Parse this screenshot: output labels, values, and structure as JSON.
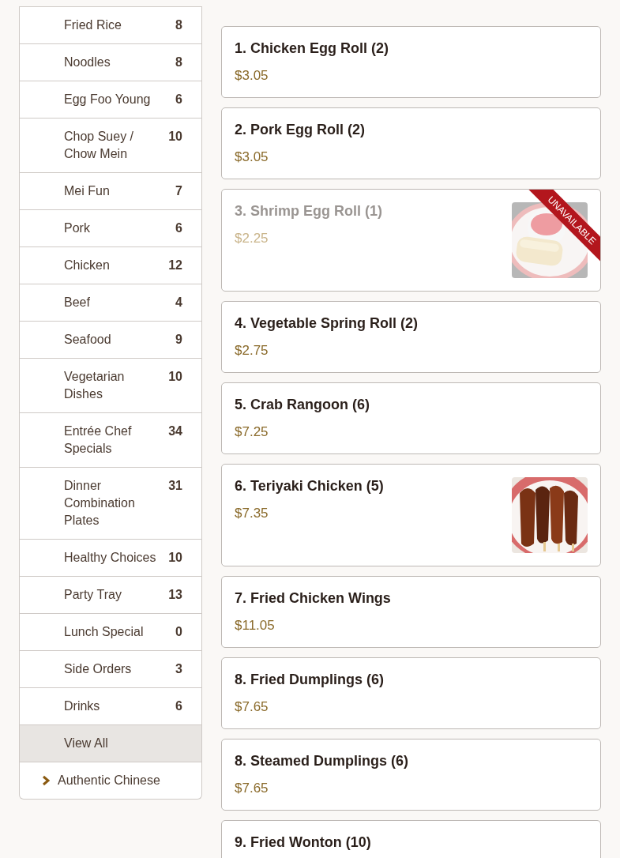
{
  "sidebar": {
    "items": [
      {
        "kind": "category",
        "label": "Fried Rice",
        "count": "8",
        "selected": false
      },
      {
        "kind": "category",
        "label": "Noodles",
        "count": "8",
        "selected": false
      },
      {
        "kind": "category",
        "label": "Egg Foo Young",
        "count": "6",
        "selected": false
      },
      {
        "kind": "category",
        "label": "Chop Suey / Chow Mein",
        "count": "10",
        "selected": false
      },
      {
        "kind": "category",
        "label": "Mei Fun",
        "count": "7",
        "selected": false
      },
      {
        "kind": "category",
        "label": "Pork",
        "count": "6",
        "selected": false
      },
      {
        "kind": "category",
        "label": "Chicken",
        "count": "12",
        "selected": false
      },
      {
        "kind": "category",
        "label": "Beef",
        "count": "4",
        "selected": false
      },
      {
        "kind": "category",
        "label": "Seafood",
        "count": "9",
        "selected": false
      },
      {
        "kind": "category",
        "label": "Vegetarian Dishes",
        "count": "10",
        "selected": false
      },
      {
        "kind": "category",
        "label": "Entrée Chef Specials",
        "count": "34",
        "selected": false
      },
      {
        "kind": "category",
        "label": "Dinner Combination Plates",
        "count": "31",
        "selected": false
      },
      {
        "kind": "category",
        "label": "Healthy Choices",
        "count": "10",
        "selected": false
      },
      {
        "kind": "category",
        "label": "Party Tray",
        "count": "13",
        "selected": false
      },
      {
        "kind": "category",
        "label": "Lunch Special",
        "count": "0",
        "selected": false
      },
      {
        "kind": "category",
        "label": "Side Orders",
        "count": "3",
        "selected": false
      },
      {
        "kind": "category",
        "label": "Drinks",
        "count": "6",
        "selected": false
      },
      {
        "kind": "category",
        "label": "View All",
        "selected": true
      },
      {
        "kind": "group",
        "label": "Authentic Chinese",
        "expanded": false
      }
    ]
  },
  "section": {
    "items": [
      {
        "name": "1. Chicken Egg Roll (2)",
        "price": "$3.05",
        "available": true
      },
      {
        "name": "2. Pork Egg Roll (2)",
        "price": "$3.05",
        "available": true
      },
      {
        "name": "3. Shrimp Egg Roll (1)",
        "price": "$2.25",
        "available": false,
        "badge": "UNAVAILABLE"
      },
      {
        "name": "4. Vegetable Spring Roll (2)",
        "price": "$2.75",
        "available": true
      },
      {
        "name": "5. Crab Rangoon (6)",
        "price": "$7.25",
        "available": true
      },
      {
        "name": "6. Teriyaki Chicken (5)",
        "price": "$7.35",
        "available": true
      },
      {
        "name": "7. Fried Chicken Wings",
        "price": "$11.05",
        "available": true
      },
      {
        "name": "8. Fried Dumplings (6)",
        "price": "$7.65",
        "available": true
      },
      {
        "name": "8. Steamed Dumplings (6)",
        "price": "$7.65",
        "available": true
      },
      {
        "name": "9. Fried Wonton (10)",
        "available": true
      }
    ]
  }
}
